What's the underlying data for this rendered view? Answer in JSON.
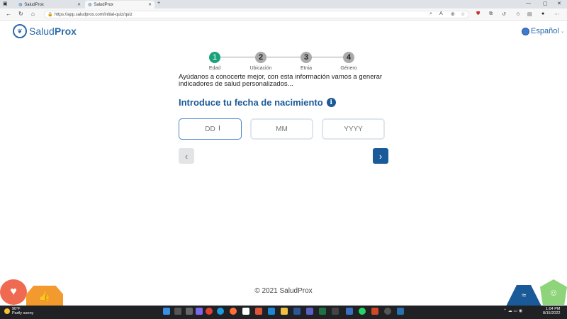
{
  "browser": {
    "tabs": [
      {
        "title": "SaludProx",
        "active": false
      },
      {
        "title": "SaludProx",
        "active": true
      }
    ],
    "new_tab": "+",
    "url": "https://app.saludprox.com/initial-quiz/quiz",
    "window_controls": {
      "minimize": "—",
      "maximize": "▢",
      "close": "✕"
    }
  },
  "header": {
    "logo_prefix": "Salud",
    "logo_suffix": "Prox",
    "language": "Español"
  },
  "stepper": {
    "steps": [
      {
        "number": "1",
        "label": "Edad",
        "active": true
      },
      {
        "number": "2",
        "label": "Ubicación",
        "active": false
      },
      {
        "number": "3",
        "label": "Etnia",
        "active": false
      },
      {
        "number": "4",
        "label": "Género",
        "active": false
      }
    ]
  },
  "intro": "Ayúdanos a conocerte mejor, con esta información vamos a generar indicadores de salud personalizados...",
  "question": "Introduce tu fecha de nacimiento",
  "inputs": {
    "day_placeholder": "DD",
    "month_placeholder": "MM",
    "year_placeholder": "YYYY"
  },
  "nav": {
    "prev": "‹",
    "next": "›"
  },
  "footer": "© 2021 SaludProx",
  "taskbar": {
    "weather_temp": "90°F",
    "weather_desc": "Partly sunny",
    "time": "1:04 PM",
    "date": "8/15/2022"
  },
  "colors": {
    "brand_blue": "#1b5a98",
    "step_active": "#1aa37a",
    "step_inactive": "#aaaaaa"
  }
}
